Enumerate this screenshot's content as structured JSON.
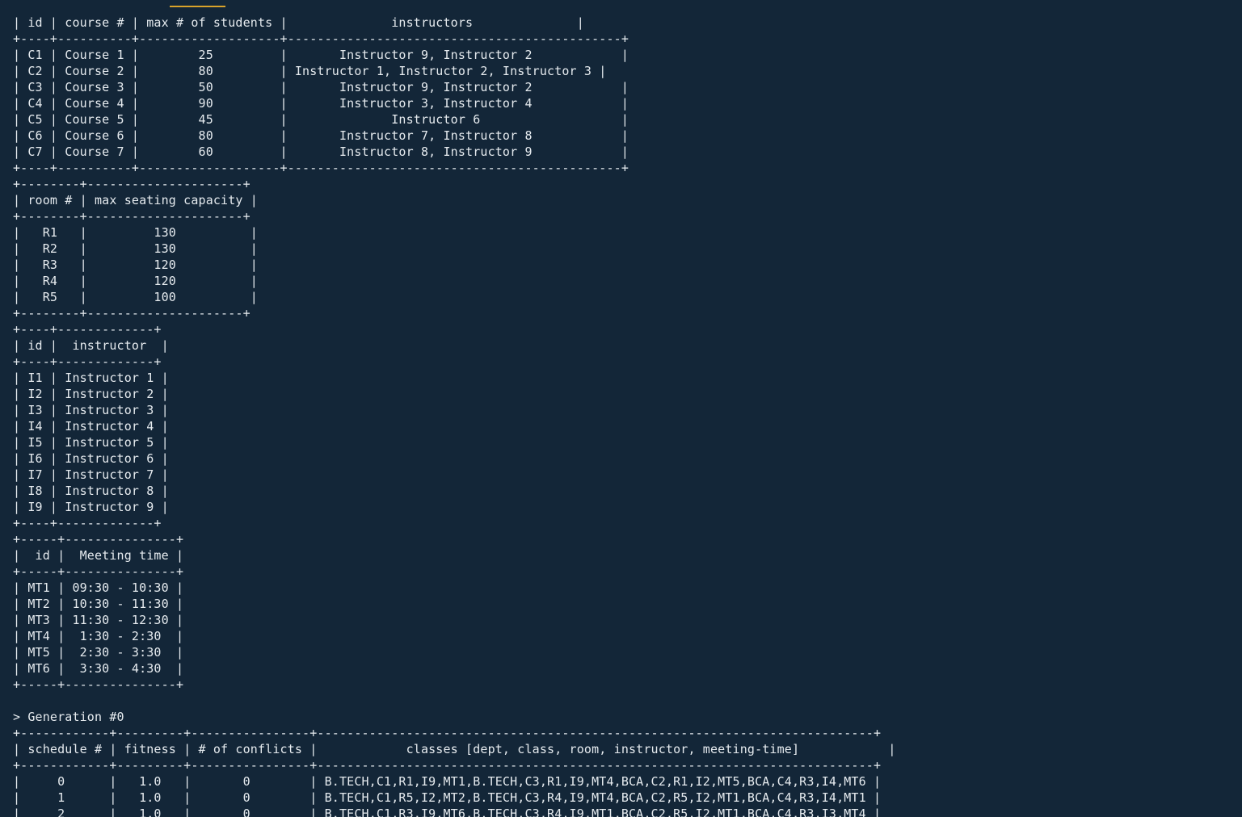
{
  "terminal": {
    "accent_color": "#d9a32a",
    "background_color": "#132638",
    "text_color": "#e6ebef",
    "lines": [
      "| id | course # | max # of students |              instructors              |",
      "+----+----------+-------------------+---------------------------------------------+",
      "| C1 | Course 1 |        25         |       Instructor 9, Instructor 2            |",
      "| C2 | Course 2 |        80         | Instructor 1, Instructor 2, Instructor 3 |",
      "| C3 | Course 3 |        50         |       Instructor 9, Instructor 2            |",
      "| C4 | Course 4 |        90         |       Instructor 3, Instructor 4            |",
      "| C5 | Course 5 |        45         |              Instructor 6                   |",
      "| C6 | Course 6 |        80         |       Instructor 7, Instructor 8            |",
      "| C7 | Course 7 |        60         |       Instructor 8, Instructor 9            |",
      "+----+----------+-------------------+---------------------------------------------+",
      "+--------+---------------------+",
      "| room # | max seating capacity |",
      "+--------+---------------------+",
      "|   R1   |         130          |",
      "|   R2   |         130          |",
      "|   R3   |         120          |",
      "|   R4   |         120          |",
      "|   R5   |         100          |",
      "+--------+---------------------+",
      "+----+-------------+",
      "| id |  instructor  |",
      "+----+-------------+",
      "| I1 | Instructor 1 |",
      "| I2 | Instructor 2 |",
      "| I3 | Instructor 3 |",
      "| I4 | Instructor 4 |",
      "| I5 | Instructor 5 |",
      "| I6 | Instructor 6 |",
      "| I7 | Instructor 7 |",
      "| I8 | Instructor 8 |",
      "| I9 | Instructor 9 |",
      "+----+-------------+",
      "+-----+---------------+",
      "|  id |  Meeting time |",
      "+-----+---------------+",
      "| MT1 | 09:30 - 10:30 |",
      "| MT2 | 10:30 - 11:30 |",
      "| MT3 | 11:30 - 12:30 |",
      "| MT4 |  1:30 - 2:30  |",
      "| MT5 |  2:30 - 3:30  |",
      "| MT6 |  3:30 - 4:30  |",
      "+-----+---------------+",
      "",
      "> Generation #0",
      "+------------+---------+----------------+---------------------------------------------------------------------------+",
      "| schedule # | fitness | # of conflicts |            classes [dept, class, room, instructor, meeting-time]            |",
      "+------------+---------+----------------+---------------------------------------------------------------------------+",
      "|     0      |   1.0   |       0        | B.TECH,C1,R1,I9,MT1,B.TECH,C3,R1,I9,MT4,BCA,C2,R1,I2,MT5,BCA,C4,R3,I4,MT6 |",
      "|     1      |   1.0   |       0        | B.TECH,C1,R5,I2,MT2,B.TECH,C3,R4,I9,MT4,BCA,C2,R5,I2,MT1,BCA,C4,R3,I4,MT1 |",
      "|     2      |   1.0   |       0        | B.TECH,C1,R3,I9,MT6,B.TECH,C3,R4,I9,MT1,BCA,C2,R5,I2,MT1,BCA,C4,R3,I3,MT4 |"
    ]
  }
}
